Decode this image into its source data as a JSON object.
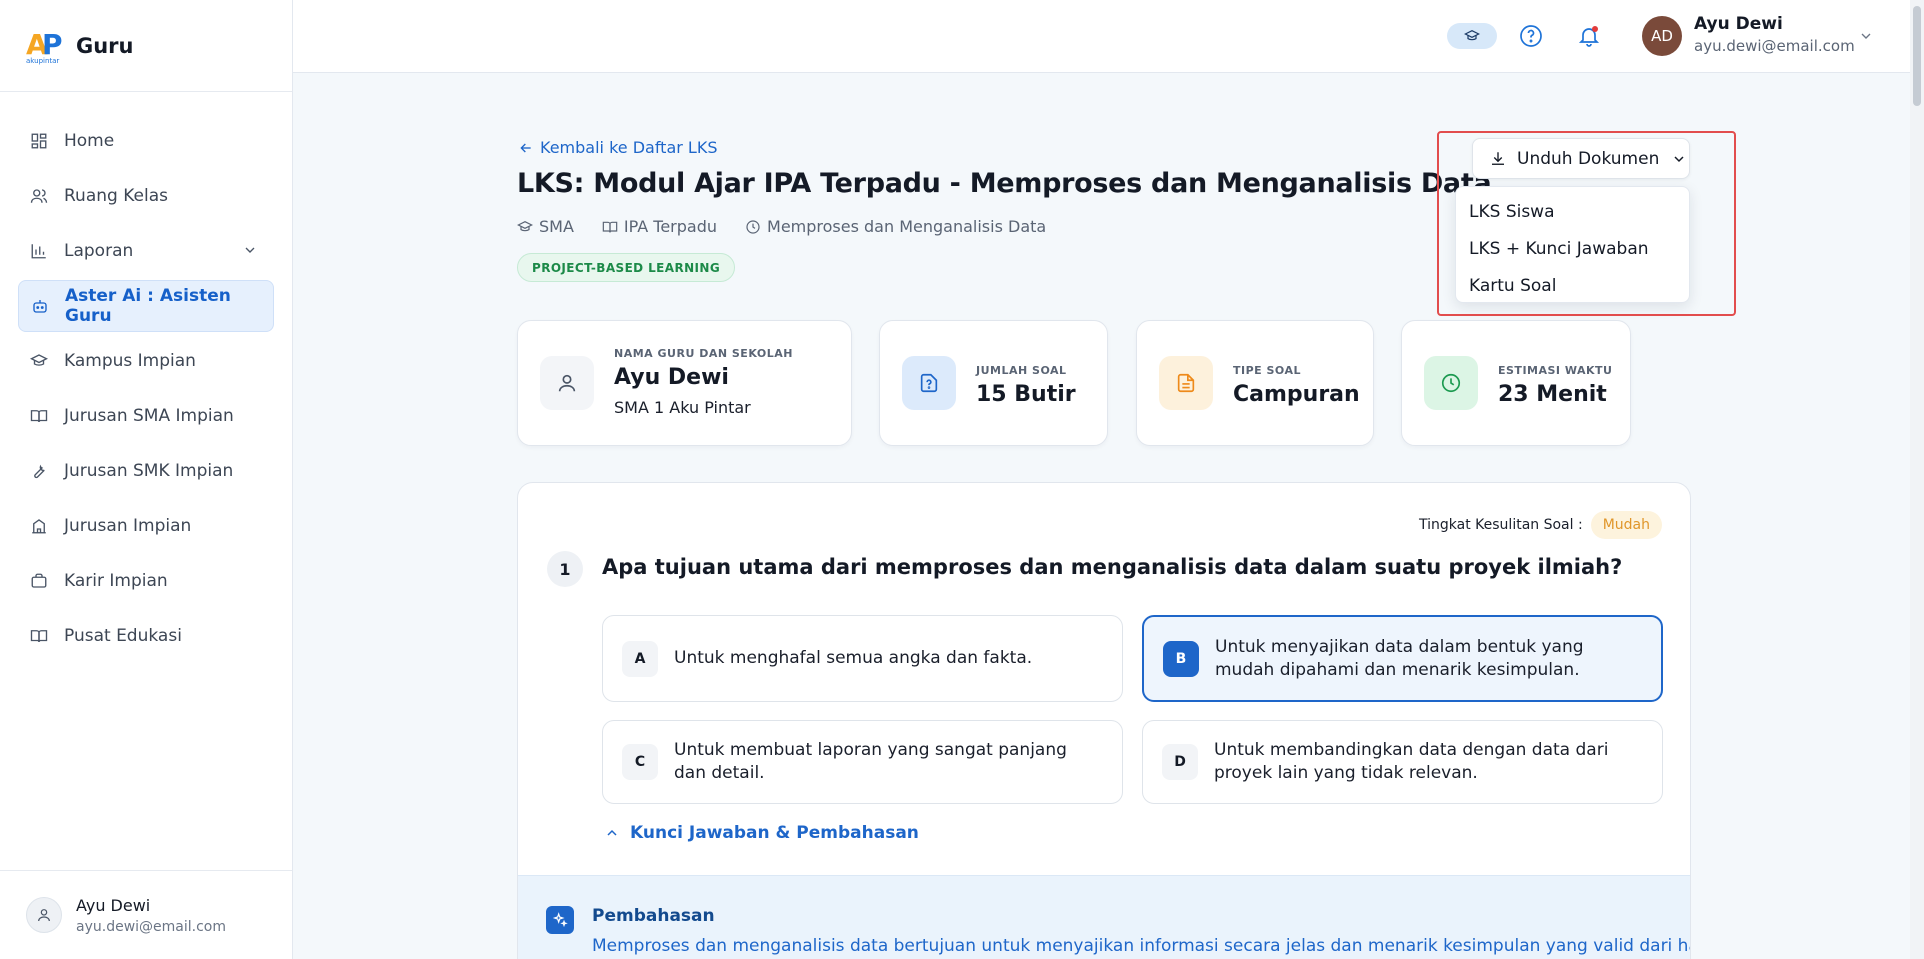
{
  "brand": {
    "logo_mark": "AP",
    "logo_sub": "akupintar",
    "app_name": "Guru"
  },
  "sidebar": {
    "items": [
      {
        "label": "Home",
        "icon": "grid-icon"
      },
      {
        "label": "Ruang Kelas",
        "icon": "users-icon"
      },
      {
        "label": "Laporan",
        "icon": "bar-chart-icon",
        "expandable": true
      },
      {
        "label": "Aster Ai : Asisten Guru",
        "icon": "robot-icon",
        "active": true
      },
      {
        "label": "Kampus Impian",
        "icon": "graduation-cap-icon"
      },
      {
        "label": "Jurusan SMA Impian",
        "icon": "book-icon"
      },
      {
        "label": "Jurusan SMK Impian",
        "icon": "wrench-icon"
      },
      {
        "label": "Jurusan Impian",
        "icon": "building-icon"
      },
      {
        "label": "Karir Impian",
        "icon": "briefcase-icon"
      },
      {
        "label": "Pusat Edukasi",
        "icon": "book-open-icon"
      }
    ],
    "user": {
      "name": "Ayu Dewi",
      "email": "ayu.dewi@email.com"
    }
  },
  "topbar": {
    "user_initials": "AD",
    "user_name": "Ayu Dewi",
    "user_email": "ayu.dewi@email.com"
  },
  "header": {
    "back_label": "Kembali ke Daftar LKS",
    "title": "LKS: Modul Ajar IPA Terpadu - Memproses dan Menganalisis Data",
    "meta": [
      "SMA",
      "IPA Terpadu",
      "Memproses dan Menganalisis Data"
    ],
    "badge": "PROJECT-BASED LEARNING"
  },
  "download": {
    "button_label": "Unduh Dokumen",
    "options": [
      "LKS Siswa",
      "LKS + Kunci Jawaban",
      "Kartu Soal"
    ]
  },
  "stats": {
    "teacher": {
      "label": "NAMA GURU DAN SEKOLAH",
      "value": "Ayu Dewi",
      "sub": "SMA 1 Aku Pintar"
    },
    "count": {
      "label": "JUMLAH SOAL",
      "value": "15 Butir"
    },
    "type": {
      "label": "TIPE SOAL",
      "value": "Campuran"
    },
    "time": {
      "label": "ESTIMASI WAKTU",
      "value": "23 Menit"
    }
  },
  "question": {
    "difficulty_label": "Tingkat Kesulitan Soal :",
    "difficulty_value": "Mudah",
    "number": "1",
    "text": "Apa tujuan utama dari memproses dan menganalisis data dalam suatu proyek ilmiah?",
    "options": [
      {
        "letter": "A",
        "text": "Untuk menghafal semua angka dan fakta."
      },
      {
        "letter": "B",
        "text": "Untuk menyajikan data dalam bentuk yang mudah dipahami dan menarik kesimpulan.",
        "selected": true
      },
      {
        "letter": "C",
        "text": "Untuk membuat laporan yang sangat panjang dan detail."
      },
      {
        "letter": "D",
        "text": "Untuk membandingkan data dengan data dari proyek lain yang tidak relevan."
      }
    ],
    "answer_toggle_label": "Kunci Jawaban & Pembahasan",
    "explanation_title": "Pembahasan",
    "explanation_text": "Memproses dan menganalisis data bertujuan untuk menyajikan informasi secara jelas dan menarik kesimpulan yang valid dari hasil"
  },
  "colors": {
    "primary": "#1e66c9",
    "success": "#1c8a48",
    "warning": "#e0962a",
    "highlight": "#e24d4d"
  }
}
